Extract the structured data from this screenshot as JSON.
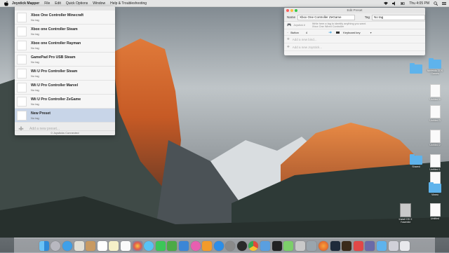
{
  "menubar": {
    "app_name": "Joystick Mapper",
    "items": [
      "File",
      "Edit",
      "Quick Options",
      "Window",
      "Help & Troubleshooting"
    ],
    "clock": "Thu 4:05 PM"
  },
  "mapper": {
    "presets": [
      {
        "name": "Xbox One Controller Minecraft",
        "tag": "No tag"
      },
      {
        "name": "Xbox one Controller Steam",
        "tag": "No tag"
      },
      {
        "name": "Xbox one Controller Rayman",
        "tag": "No tag"
      },
      {
        "name": "GamePad Pro USB Steam",
        "tag": "No tag"
      },
      {
        "name": "Wii U Pro Controller Steam",
        "tag": "No tag"
      },
      {
        "name": "Wii U Pro Controller Marvel",
        "tag": "No tag"
      },
      {
        "name": "Wii U Pro Controller ZeGame",
        "tag": "No tag"
      },
      {
        "name": "New Preset",
        "tag": "No tag"
      }
    ],
    "add_preset": "Add a new preset...",
    "footer": "0 Joysticks Connected"
  },
  "edit_preset": {
    "title": "Edit Preset",
    "name_label": "Name",
    "name_value": "Xbox One Controller ZeGame",
    "tag_label": "Tag",
    "tag_value": "No tag",
    "joystick_label": "Joystick #",
    "hint_line1": "Write here a tag to identify anything you want.",
    "hint_line2": "Xbox One Wired Controller",
    "bind_source": "Button",
    "bind_value": "4",
    "bind_target": "Keyboard key",
    "add_bind": "Add a new bind...",
    "add_joystick": "Add a new Joystick..."
  },
  "desktop_icons": [
    {
      "label": "Nintendo 3DS Games",
      "kind": "folder"
    },
    {
      "label": "Untitled 4",
      "kind": "doc"
    },
    {
      "label": "Untitled 3",
      "kind": "doc"
    },
    {
      "label": "Untitled 2",
      "kind": "doc"
    },
    {
      "label": "Shared",
      "kind": "folder"
    },
    {
      "label": "Untitled 1",
      "kind": "doc"
    },
    {
      "label": "Untitled",
      "kind": "doc"
    },
    {
      "label": "Vimeo",
      "kind": "folder"
    },
    {
      "label": "Untitled",
      "kind": "doc"
    },
    {
      "label": "Install OS X Yosemite",
      "kind": "drive"
    }
  ],
  "colors": {
    "selection": "#c8d5e8",
    "folder": "#5eb3ec",
    "close": "#fc605c",
    "minimize": "#fdbc40",
    "zoom": "#34c84a"
  }
}
